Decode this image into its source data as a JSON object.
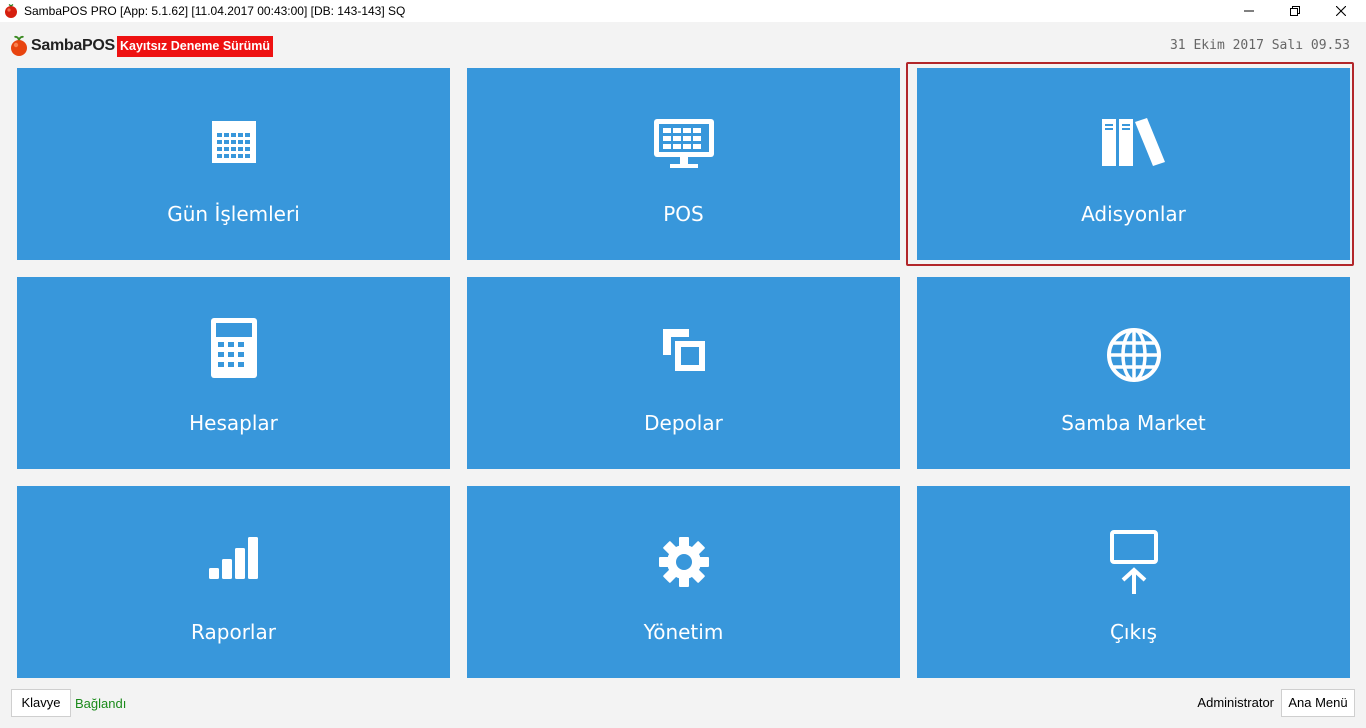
{
  "window": {
    "title": "SambaPOS PRO [App: 5.1.62] [11.04.2017 00:43:00] [DB: 143-143] SQ"
  },
  "header": {
    "brand": "SambaPOS",
    "trial_badge": "Kayıtsız Deneme Sürümü",
    "datetime": "31 Ekim 2017 Salı 09.53"
  },
  "tiles": [
    {
      "label": "Gün İşlemleri",
      "icon": "calendar-icon"
    },
    {
      "label": "POS",
      "icon": "pos-terminal-icon"
    },
    {
      "label": "Adisyonlar",
      "icon": "books-icon",
      "focused": true
    },
    {
      "label": "Hesaplar",
      "icon": "calculator-icon"
    },
    {
      "label": "Depolar",
      "icon": "copy-icon"
    },
    {
      "label": "Samba Market",
      "icon": "globe-icon"
    },
    {
      "label": "Raporlar",
      "icon": "signal-bars-icon"
    },
    {
      "label": "Yönetim",
      "icon": "gear-icon"
    },
    {
      "label": "Çıkış",
      "icon": "screen-upload-icon"
    }
  ],
  "footer": {
    "keyboard_button": "Klavye",
    "status": "Bağlandı",
    "user": "Administrator",
    "main_menu_button": "Ana Menü"
  },
  "colors": {
    "tile": "#3897db",
    "focus_ring": "#b2262a",
    "trial_badge": "#ee1111",
    "status_connected": "#1a8a1a"
  }
}
